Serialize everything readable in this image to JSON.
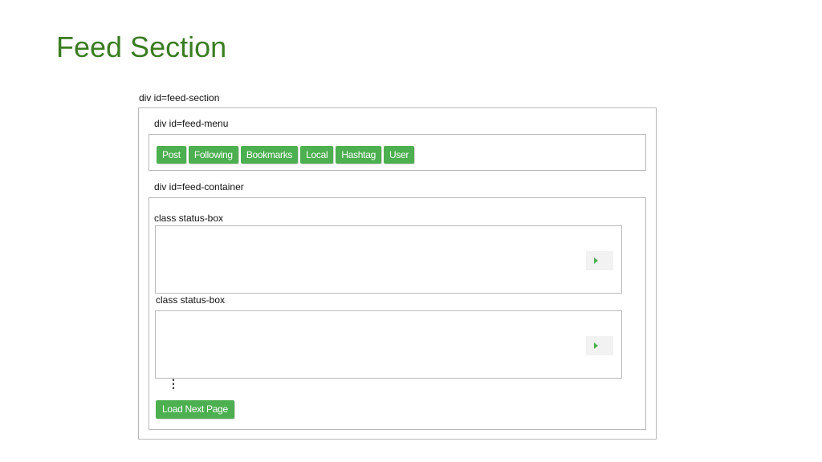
{
  "slide": {
    "title": "Feed Section"
  },
  "feed_section": {
    "label": "div id=feed-section"
  },
  "feed_menu": {
    "label": "div id=feed-menu",
    "buttons": [
      "Post",
      "Following",
      "Bookmarks",
      "Local",
      "Hashtag",
      "User"
    ]
  },
  "feed_container": {
    "label": "div id=feed-container",
    "status_boxes": [
      {
        "label": "class status-box",
        "action_icon": "play-icon"
      },
      {
        "label": "class status-box",
        "action_icon": "play-icon"
      }
    ],
    "more_indicator": "⋮",
    "load_button": "Load Next Page"
  },
  "colors": {
    "title": "#3a7d22",
    "button_bg": "#4caf50",
    "button_text": "#ffffff",
    "border": "#b8b8b8"
  }
}
